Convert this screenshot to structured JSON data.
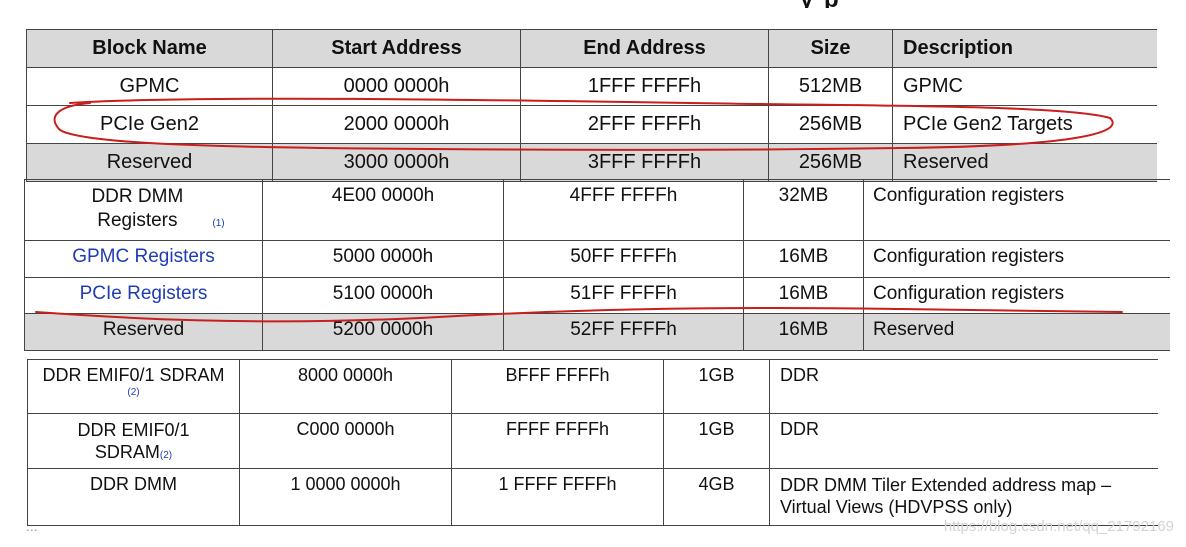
{
  "cutoff_heading": "y p",
  "table1": {
    "headers": [
      "Block Name",
      "Start Address",
      "End Address",
      "Size",
      "Description"
    ],
    "rows": [
      [
        "GPMC",
        "0000 0000h",
        "1FFF FFFFh",
        "512MB",
        "GPMC"
      ],
      [
        "PCIe Gen2",
        "2000 0000h",
        "2FFF FFFFh",
        "256MB",
        "PCIe Gen2 Targets"
      ],
      [
        "Reserved",
        "3000 0000h",
        "3FFF FFFFh",
        "256MB",
        "Reserved"
      ]
    ]
  },
  "table2": {
    "rows": [
      {
        "name": "DDR DMM Registers",
        "footnote": "(1)",
        "start": "4E00 0000h",
        "end": "4FFF FFFFh",
        "size": "32MB",
        "desc": "Configuration registers"
      },
      {
        "name": "GPMC Registers",
        "start": "5000 0000h",
        "end": "50FF FFFFh",
        "size": "16MB",
        "desc": "Configuration registers"
      },
      {
        "name": "PCIe Registers",
        "start": "5100 0000h",
        "end": "51FF FFFFh",
        "size": "16MB",
        "desc": "Configuration registers"
      },
      {
        "name": "Reserved",
        "start": "5200 0000h",
        "end": "52FF FFFFh",
        "size": "16MB",
        "desc": "Reserved"
      }
    ]
  },
  "table3": {
    "rows": [
      {
        "name": "DDR EMIF0/1 SDRAM",
        "footnote": "(2)",
        "start": "8000 0000h",
        "end": "BFFF FFFFh",
        "size": "1GB",
        "desc": "DDR"
      },
      {
        "name_line1": "DDR EMIF0/1",
        "name_line2": "SDRAM",
        "footnote": "(2)",
        "start": "C000 0000h",
        "end": "FFFF FFFFh",
        "size": "1GB",
        "desc": "DDR"
      },
      {
        "name": "DDR DMM",
        "start": "1 0000 0000h",
        "end": "1 FFFF FFFFh",
        "size": "4GB",
        "desc_line1": "DDR DMM Tiler Extended address map –",
        "desc_line2": "Virtual Views (HDVPSS only)"
      }
    ]
  },
  "footer": {
    "ellipsis": "...",
    "watermark": "https://blog.csdn.net/qq_21792169"
  },
  "colors": {
    "header_bg": "#d9d9d9",
    "link_blue": "#1f3cb4",
    "annotation_red": "#c81e1e"
  }
}
